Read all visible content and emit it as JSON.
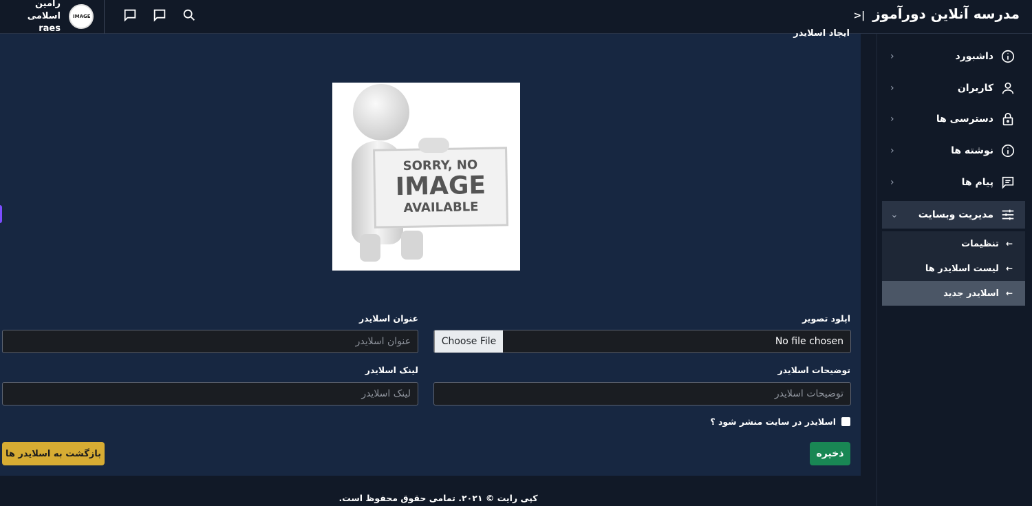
{
  "brand": {
    "title": "مدرسه آنلاین دورآموز",
    "toggle": "|<"
  },
  "user": {
    "name": "رامین اسلامی",
    "username": "raes",
    "avatar_text": "IMAGE"
  },
  "topbar_icons": [
    "chat-icon",
    "message-icon",
    "search-icon"
  ],
  "sidebar": {
    "items": [
      {
        "label": "داشبورد",
        "icon": "info-icon"
      },
      {
        "label": "کاربران",
        "icon": "user-icon"
      },
      {
        "label": "دسترسی ها",
        "icon": "lock-icon"
      },
      {
        "label": "نوشته ها",
        "icon": "info-icon"
      },
      {
        "label": "پیام ها",
        "icon": "message-icon"
      },
      {
        "label": "مدیریت وبسایت",
        "icon": "sliders-icon"
      }
    ],
    "subitems": [
      {
        "label": "تنظیمات"
      },
      {
        "label": "لیست اسلایدر ها"
      },
      {
        "label": "اسلایدر جدید"
      }
    ]
  },
  "main": {
    "title": "ایجاد اسلایدر",
    "placeholder_image": {
      "line1": "SORRY, NO",
      "line2": "IMAGE",
      "line3": "AVAILABLE"
    },
    "form": {
      "upload_label": "اپلود تصویر",
      "choose_file": "Choose File",
      "no_file": "No file chosen",
      "title_label": "عنوان اسلایدر",
      "title_placeholder": "عنوان اسلایدر",
      "desc_label": "توضیحات اسلایدر",
      "desc_placeholder": "توضیحات اسلایدر",
      "link_label": "لینک اسلایدر",
      "link_placeholder": "لینک اسلایدر",
      "publish_label": "اسلایدر در سایت منشر شود ؟",
      "save_label": "ذخیره",
      "back_label": "بازگشت به اسلایدر ها"
    }
  },
  "footer": {
    "text": "کپی رایت © ۲۰۲۱. تمامی حقوق محفوظ است."
  },
  "colors": {
    "save": "#198754",
    "back": "#d7ac33",
    "panel": "#172741",
    "bg": "#111927"
  }
}
